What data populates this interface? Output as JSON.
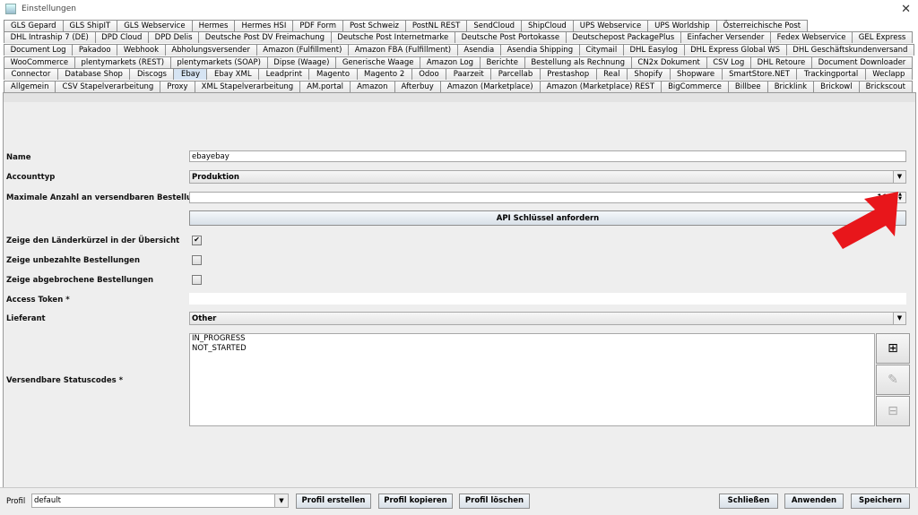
{
  "window": {
    "title": "Einstellungen"
  },
  "tabs": {
    "row1": [
      "GLS Gepard",
      "GLS ShipIT",
      "GLS Webservice",
      "Hermes",
      "Hermes HSI",
      "PDF Form",
      "Post Schweiz",
      "PostNL REST",
      "SendCloud",
      "ShipCloud",
      "UPS Webservice",
      "UPS Worldship",
      "Österreichische Post"
    ],
    "row2": [
      "DHL Intraship 7 (DE)",
      "DPD Cloud",
      "DPD Delis",
      "Deutsche Post DV Freimachung",
      "Deutsche Post Internetmarke",
      "Deutsche Post Portokasse",
      "Deutschepost PackagePlus",
      "Einfacher Versender",
      "Fedex Webservice",
      "GEL Express"
    ],
    "row3": [
      "Document Log",
      "Pakadoo",
      "Webhook",
      "Abholungsversender",
      "Amazon (Fulfillment)",
      "Amazon FBA (Fulfillment)",
      "Asendia",
      "Asendia Shipping",
      "Citymail",
      "DHL Easylog",
      "DHL Express Global WS",
      "DHL Geschäftskundenversand"
    ],
    "row4": [
      "WooCommerce",
      "plentymarkets (REST)",
      "plentymarkets (SOAP)",
      "Dipse (Waage)",
      "Generische Waage",
      "Amazon Log",
      "Berichte",
      "Bestellung als Rechnung",
      "CN2x Dokument",
      "CSV Log",
      "DHL Retoure",
      "Document Downloader"
    ],
    "row5": [
      "Connector",
      "Database Shop",
      "Discogs",
      "Ebay",
      "Ebay XML",
      "Leadprint",
      "Magento",
      "Magento 2",
      "Odoo",
      "Paarzeit",
      "Parcellab",
      "Prestashop",
      "Real",
      "Shopify",
      "Shopware",
      "SmartStore.NET",
      "Trackingportal",
      "Weclapp"
    ],
    "row6": [
      "Allgemein",
      "CSV Stapelverarbeitung",
      "Proxy",
      "XML Stapelverarbeitung",
      "AM.portal",
      "Amazon",
      "Afterbuy",
      "Amazon (Marketplace)",
      "Amazon (Marketplace) REST",
      "BigCommerce",
      "Billbee",
      "Bricklink",
      "Brickowl",
      "Brickscout"
    ],
    "active": "Ebay"
  },
  "form": {
    "name_label": "Name",
    "name_value": "ebayebay",
    "accounttyp_label": "Accounttyp",
    "accounttyp_value": "Produktion",
    "max_label": "Maximale Anzahl an versendbaren Bestellungen",
    "max_value": "100",
    "api_button": "API Schlüssel anfordern",
    "show_country_label": "Zeige den Länderkürzel in der Übersicht",
    "show_unpaid_label": "Zeige unbezahlte Bestellungen",
    "show_cancelled_label": "Zeige abgebrochene Bestellungen",
    "access_token_label": "Access Token *",
    "lieferant_label": "Lieferant",
    "lieferant_value": "Other",
    "status_label": "Versendbare Statuscodes *",
    "status_codes": [
      "IN_PROGRESS",
      "NOT_STARTED"
    ]
  },
  "footer": {
    "profile_label": "Profil",
    "profile_value": "default",
    "create": "Profil erstellen",
    "copy": "Profil kopieren",
    "delete": "Profil löschen",
    "close": "Schließen",
    "apply": "Anwenden",
    "save": "Speichern"
  },
  "colors": {
    "arrow": "#e8161b",
    "active_tab": "#d6e4f3"
  }
}
